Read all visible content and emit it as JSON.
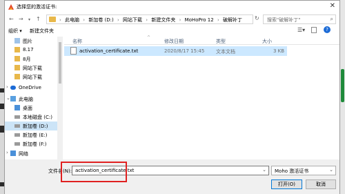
{
  "window": {
    "title": "选择您的激活证书:",
    "close_icon": "close-icon"
  },
  "address": {
    "crumbs": [
      "此电脑",
      "新加卷 (D:)",
      "网站下载",
      "新建文件夹",
      "MoHoPro 12",
      "破解补丁"
    ],
    "search_placeholder": "搜索\"破解补丁\""
  },
  "toolbar": {
    "organize": "组织 ▾",
    "new_folder": "新建文件夹"
  },
  "sidebar": {
    "items": [
      {
        "label": "图片",
        "icon": "folder-icon"
      },
      {
        "label": "8.17",
        "icon": "folder-icon"
      },
      {
        "label": "8月",
        "icon": "folder-icon"
      },
      {
        "label": "网站下载",
        "icon": "folder-icon"
      },
      {
        "label": "网站下载",
        "icon": "folder-icon"
      },
      {
        "label": "OneDrive",
        "icon": "cloud-icon"
      },
      {
        "label": "此电脑",
        "icon": "computer-icon"
      },
      {
        "label": "桌面",
        "icon": "desktop-icon"
      },
      {
        "label": "本地磁盘 (C:)",
        "icon": "drive-icon"
      },
      {
        "label": "新加卷 (D:)",
        "icon": "drive-icon"
      },
      {
        "label": "新加卷 (E:)",
        "icon": "drive-icon"
      },
      {
        "label": "新加卷 (F:)",
        "icon": "drive-icon"
      },
      {
        "label": "网络",
        "icon": "network-icon"
      }
    ]
  },
  "columns": {
    "name": "名称",
    "date": "修改日期",
    "type": "类型",
    "size": "大小"
  },
  "files": [
    {
      "name": "activation_certificate.txt",
      "date": "2020/8/17 15:45",
      "type": "文本文档",
      "size": "3 KB"
    }
  ],
  "footer": {
    "filename_label": "文件名(N):",
    "filename_value": "activation_certificate.txt",
    "filetype_value": "Moho 激活证书",
    "open_button": "打开(O)",
    "cancel_button": "取消"
  },
  "colors": {
    "selection": "#cce8ff",
    "highlight_box": "#e02020",
    "accent": "#0078d7"
  }
}
